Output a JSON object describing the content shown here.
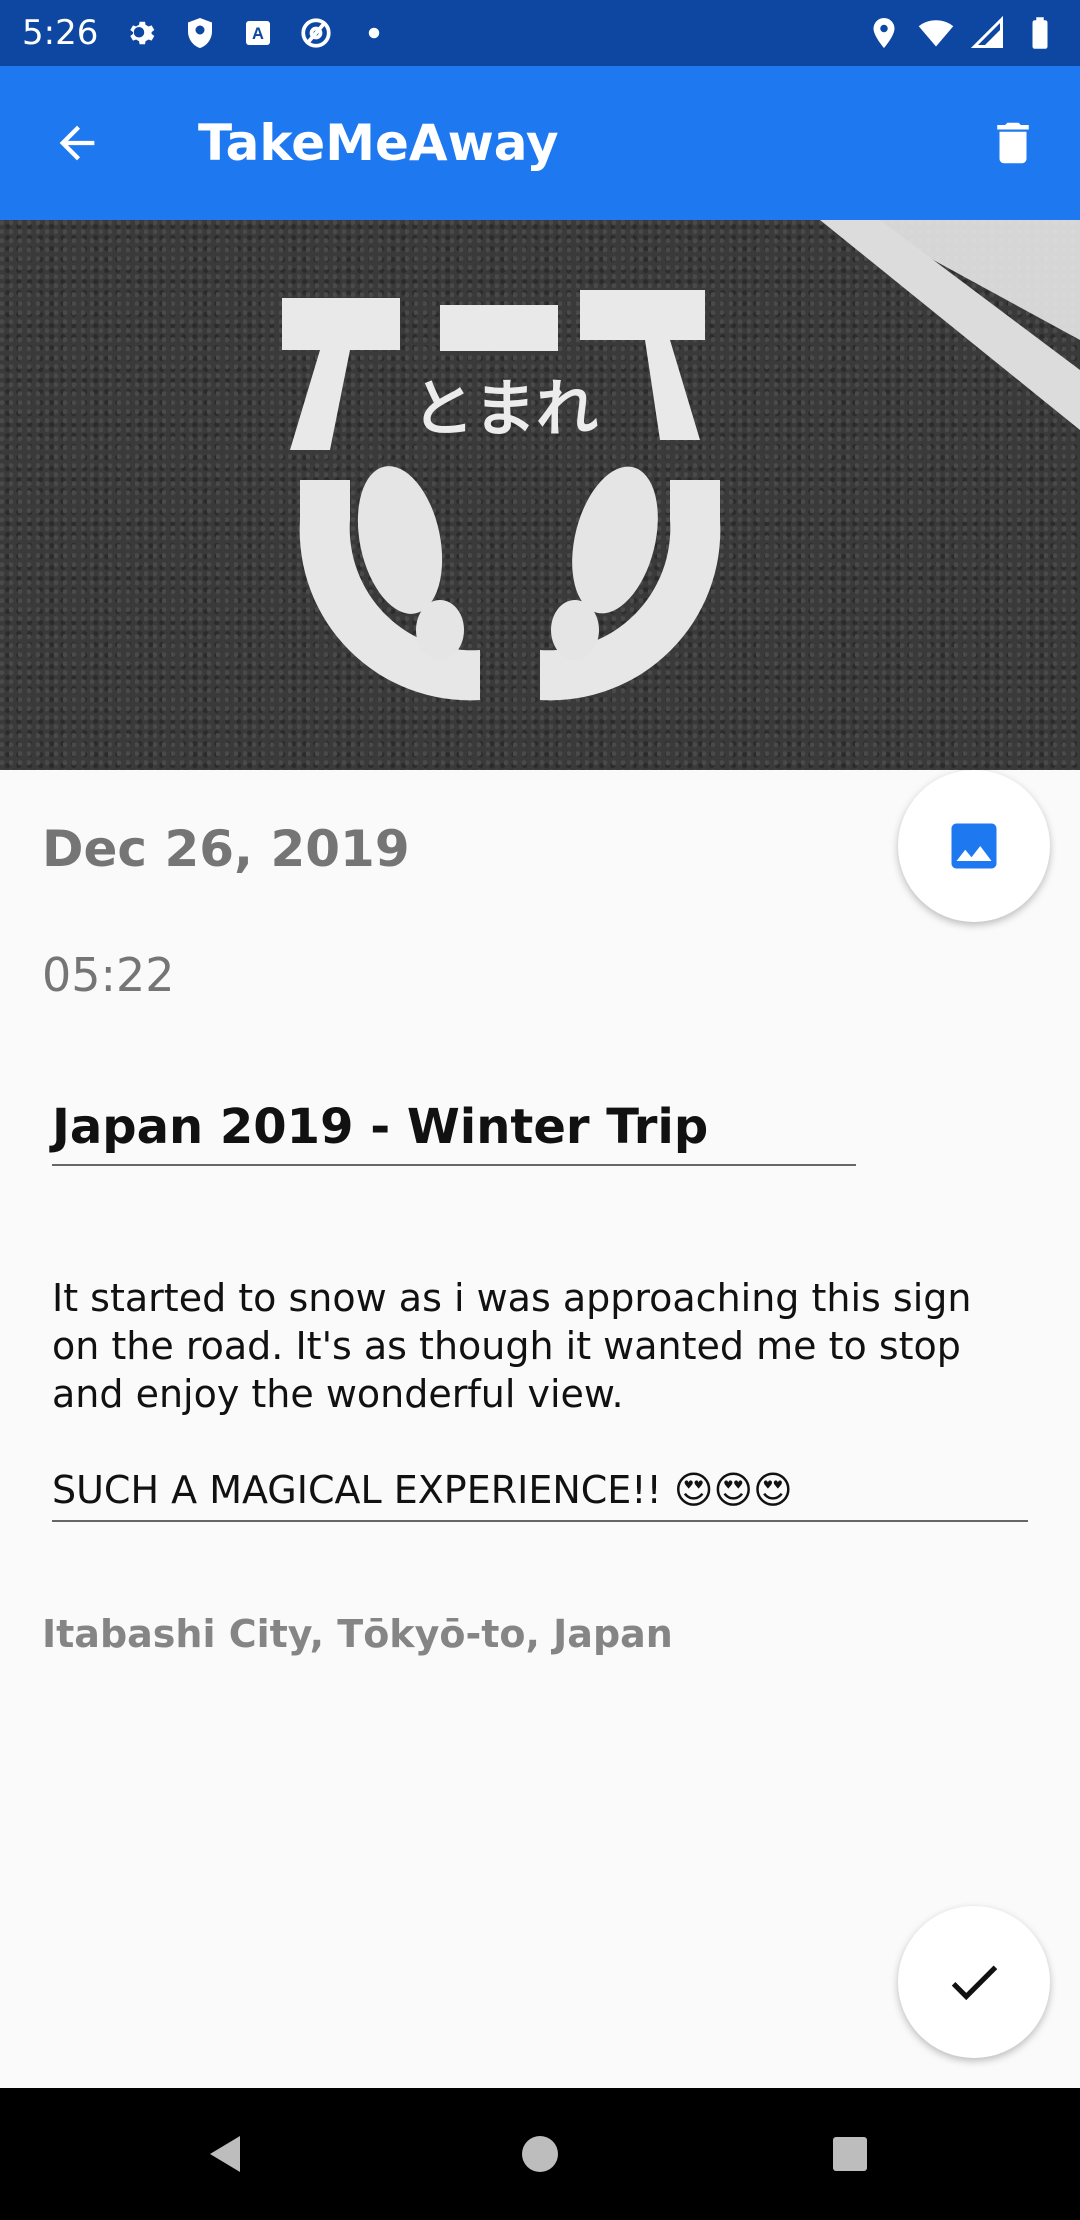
{
  "status_bar": {
    "time": "5:26",
    "left_icons": [
      "gear-icon",
      "shield-icon",
      "font-icon",
      "at-icon",
      "dot-icon"
    ],
    "right_icons": [
      "location-icon",
      "wifi-icon",
      "signal-icon",
      "battery-icon"
    ]
  },
  "app_bar": {
    "title": "TakeMeAway",
    "back_icon": "arrow-back-icon",
    "delete_icon": "trash-icon",
    "color": "#1e78f0"
  },
  "entry": {
    "date": "Dec 26, 2019",
    "time": "05:22",
    "title": "Japan 2019 - Winter Trip",
    "description_para1": "It started to snow as i was approaching this sign on the road. It's as though it wanted me to stop and enjoy the wonderful view.",
    "description_para2": "SUCH A MAGICAL EXPERIENCE!! 😍😍😍",
    "location": "Itabashi City, Tōkyō-to, Japan",
    "photo_sign_text": "とまれ"
  },
  "actions": {
    "pick_image_icon": "image-icon",
    "save_icon": "check-icon"
  },
  "nav_bar": {
    "icons": [
      "nav-back-icon",
      "nav-home-icon",
      "nav-recents-icon"
    ]
  }
}
